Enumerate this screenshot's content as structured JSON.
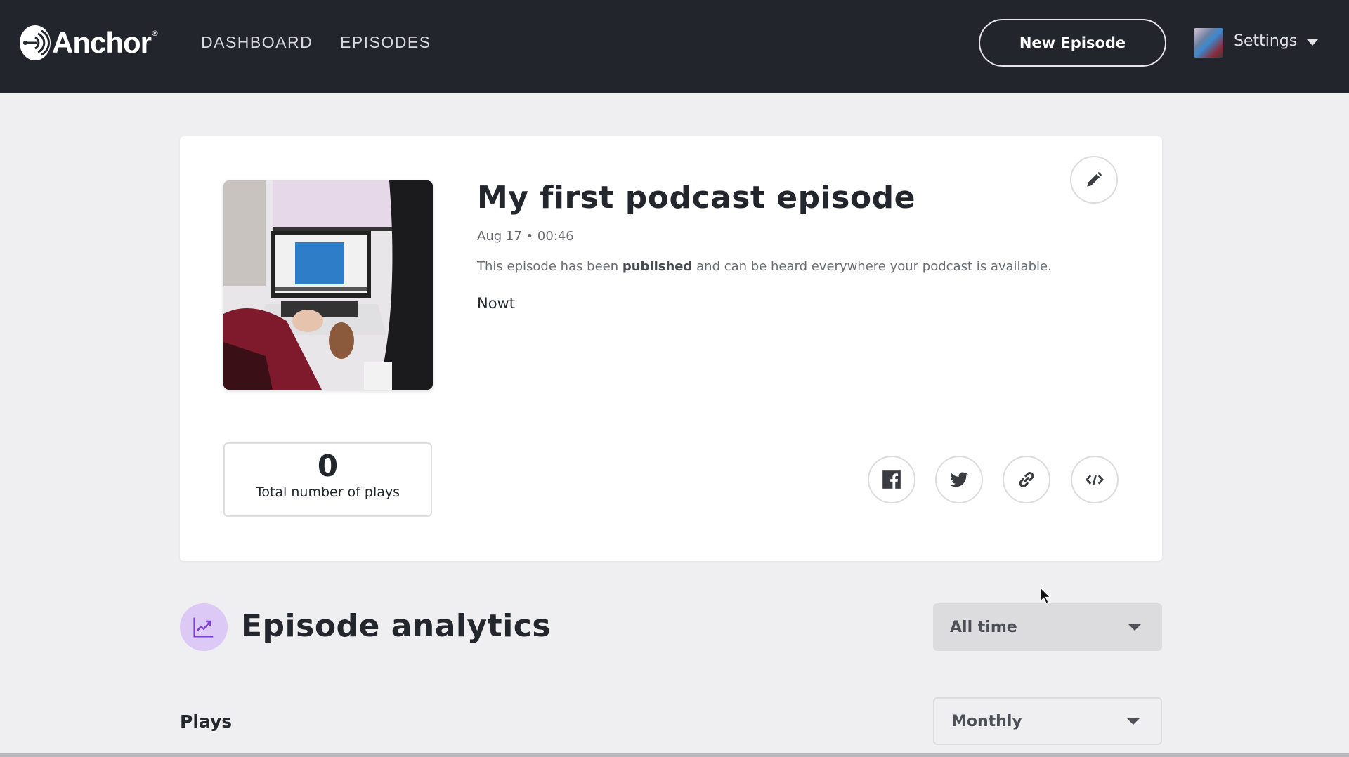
{
  "header": {
    "brand": "Anchor",
    "brand_mark": "®",
    "nav": [
      {
        "label": "DASHBOARD"
      },
      {
        "label": "EPISODES"
      }
    ],
    "new_episode_label": "New Episode",
    "settings_label": "Settings"
  },
  "episode": {
    "title": "My first podcast episode",
    "date": "Aug 17",
    "separator": "•",
    "duration": "00:46",
    "status_prefix": "This episode has been ",
    "status_bold": "published",
    "status_suffix": " and can be heard everywhere your podcast is available.",
    "description": "Nowt",
    "total_plays": "0",
    "total_plays_label": "Total number of plays",
    "share_icons": [
      "facebook-icon",
      "twitter-icon",
      "link-icon",
      "embed-code-icon"
    ]
  },
  "analytics": {
    "title": "Episode analytics",
    "range_selected": "All time",
    "plays_heading": "Plays",
    "interval_selected": "Monthly"
  },
  "colors": {
    "header_bg": "#23252d",
    "page_bg": "#efeff1",
    "analytics_icon_bg": "#dcc9f5",
    "analytics_icon_fg": "#7a3fd1"
  }
}
